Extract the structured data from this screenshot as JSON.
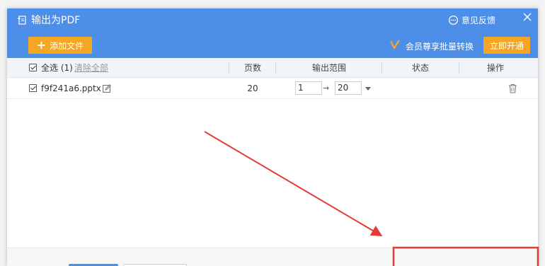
{
  "window": {
    "title": "输出为PDF",
    "feedback_label": "意见反馈",
    "close_icon": "close-icon"
  },
  "toolbar": {
    "add_file_label": "添加文件",
    "vip_text": "会员尊享批量转换",
    "open_label": "立即开通"
  },
  "table": {
    "select_all_label": "全选 (1)",
    "clear_all_label": "清除全部",
    "columns": [
      "页数",
      "输出范围",
      "状态",
      "操作"
    ],
    "rows": [
      {
        "filename": "f9f241a6.pptx",
        "pages": "20",
        "range_from": "1",
        "range_to": "20",
        "range_arrow": "→",
        "status": ""
      }
    ]
  },
  "colors": {
    "header_blue": "#4d8fe8",
    "accent_orange": "#f5a623",
    "annotation_red": "#e53935"
  }
}
